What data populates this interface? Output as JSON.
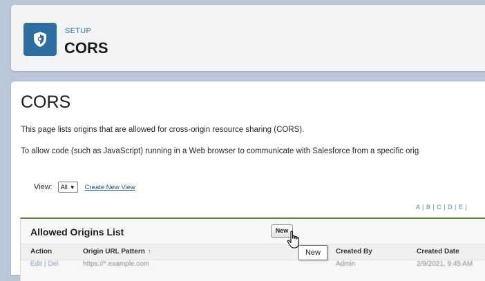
{
  "header": {
    "breadcrumb": "SETUP",
    "title": "CORS",
    "icon": "shield-icon"
  },
  "main": {
    "title": "CORS",
    "description_1": "This page lists origins that are allowed for cross-origin resource sharing (CORS).",
    "description_2": "To allow code (such as JavaScript) running in a Web browser to communicate with Salesforce from a specific orig",
    "view_label": "View:",
    "view_selected": "All",
    "create_view_link": "Create New View",
    "alpha_nav": "A | B | C | D | E |"
  },
  "list": {
    "title": "Allowed Origins List",
    "new_button": "New",
    "columns": {
      "action": "Action",
      "origin": "Origin URL Pattern",
      "created_by": "Created By",
      "created_date": "Created Date"
    },
    "sort_indicator": "↑",
    "row": {
      "action": "Edit | Del",
      "origin": "https://*.example.com",
      "created_by": "Admin",
      "created_date": "2/9/2021, 9:45 AM"
    }
  },
  "tooltip": "New",
  "colors": {
    "accent": "#2d6fa3",
    "list_border": "#5a8a2c",
    "background": "#b9c7d6"
  }
}
